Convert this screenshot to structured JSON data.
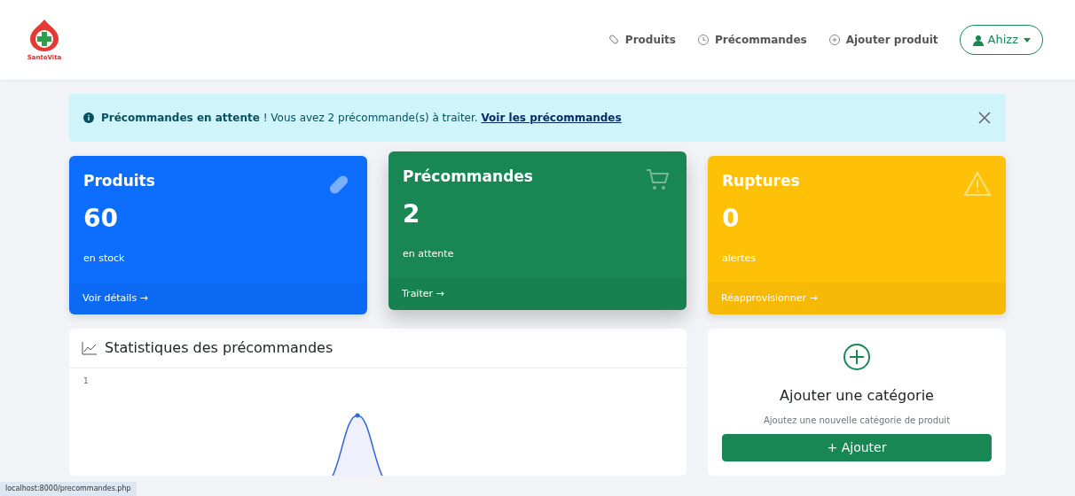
{
  "brand": {
    "name": "SanteVita"
  },
  "nav": [
    {
      "label": "Produits",
      "kind": "bandage"
    },
    {
      "label": "Précommandes",
      "kind": "clock"
    },
    {
      "label": "Ajouter produit",
      "kind": "plus"
    }
  ],
  "user": {
    "label": "Ahizz"
  },
  "alert": {
    "title": "Précommandes en attente",
    "text": " ! Vous avez 2 précommande(s) à traiter. ",
    "link": "Voir les précommandes"
  },
  "stats": [
    {
      "title": "Produits",
      "value": "60",
      "caption": "en stock",
      "link": "Voir détails →",
      "kind": "pill",
      "color": "#0d6efd",
      "raised": false
    },
    {
      "title": "Précommandes",
      "value": "2",
      "caption": "en attente",
      "link": "Traiter →",
      "kind": "cart",
      "color": "#198754",
      "raised": true
    },
    {
      "title": "Ruptures",
      "value": "0",
      "caption": "alertes",
      "link": "Réapprovisionner →",
      "kind": "warning",
      "color": "#ffc107",
      "raised": false
    }
  ],
  "chart_panel": {
    "title": "Statistiques des précommandes",
    "tick": "1"
  },
  "category_panel": {
    "title": "Ajouter une catégorie",
    "subtitle": "Ajoutez une nouvelle catégorie de produit",
    "button": "+ Ajouter"
  },
  "status_bar": {
    "url": "localhost:8000/precommandes.php"
  }
}
